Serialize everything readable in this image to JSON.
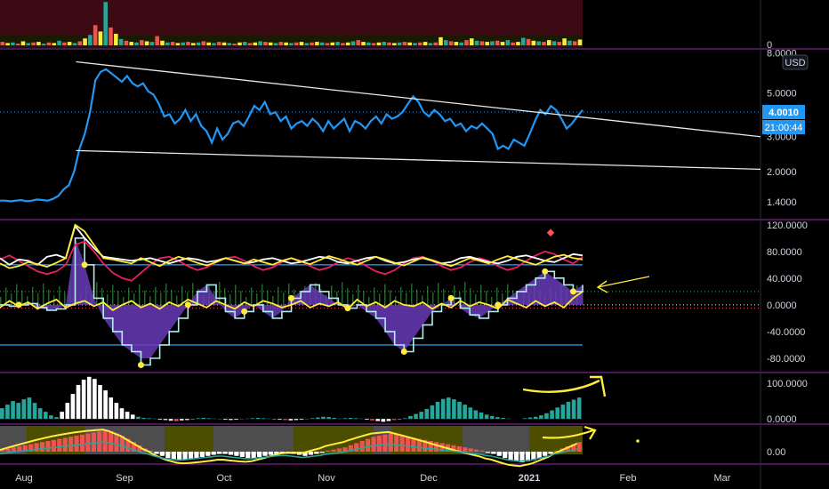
{
  "currency_button": "USD",
  "price_tag": "4.0010",
  "countdown_tag": "21:00:44",
  "colors": {
    "background": "#000000",
    "pane_border": "#9c27b0",
    "price_line": "#2196f3",
    "trendline": "#e8e8e8",
    "tag_blue": "#2196f3",
    "volume_bg": "#3b0a12",
    "osc_yellow": "#ffeb3b",
    "osc_white": "#ffffff",
    "osc_red": "#e91e63",
    "osc_purple": "#673ab7",
    "osc_green": "#4caf50",
    "hist_teal": "#26a69a",
    "hist_white": "#ffffff",
    "hist_red": "#ef5350",
    "level_blue": "#2196f3",
    "annotation_yellow": "#ffeb3b"
  },
  "chart_data": [
    {
      "type": "bar",
      "pane": "volume",
      "yticks": [
        "0"
      ],
      "ylim": [
        0,
        8
      ],
      "values": [
        0.6,
        0.4,
        0.5,
        0.3,
        0.7,
        0.4,
        0.5,
        0.6,
        0.3,
        0.5,
        0.4,
        0.8,
        0.5,
        0.6,
        0.4,
        0.7,
        1.2,
        1.8,
        3.5,
        2.4,
        7.5,
        3.1,
        2.0,
        1.1,
        0.8,
        0.6,
        0.5,
        0.9,
        0.7,
        0.6,
        1.6,
        0.8,
        0.5,
        0.6,
        0.4,
        0.5,
        0.6,
        0.4,
        0.5,
        0.7,
        0.5,
        0.4,
        0.6,
        0.5,
        0.4,
        0.3,
        0.5,
        0.6,
        0.4,
        0.5,
        0.7,
        0.6,
        0.5,
        0.4,
        0.6,
        0.5,
        0.4,
        0.5,
        0.6,
        0.4,
        0.5,
        0.6,
        0.5,
        0.4,
        0.5,
        0.6,
        0.4,
        0.5,
        0.7,
        0.9,
        0.6,
        0.5,
        0.4,
        0.5,
        0.6,
        0.5,
        0.4,
        0.5,
        0.6,
        0.5,
        0.4,
        0.5,
        0.6,
        0.4,
        0.5,
        1.4,
        0.9,
        0.7,
        0.6,
        0.5,
        0.9,
        1.2,
        0.8,
        0.7,
        0.6,
        0.7,
        0.8,
        0.6,
        0.9,
        0.5,
        0.6,
        1.3,
        1.1,
        0.8,
        0.7,
        0.6,
        0.9,
        0.7,
        0.6,
        1.2,
        0.8,
        0.7,
        1.0
      ]
    },
    {
      "type": "line",
      "pane": "price",
      "scale": "log",
      "x_labels": [
        "Aug",
        "Sep",
        "Oct",
        "Nov",
        "Dec",
        "2021",
        "Feb",
        "Mar"
      ],
      "yticks": [
        "8.0000",
        "5.0000",
        "3.0000",
        "2.0000",
        "1.4000"
      ],
      "ytick_values": [
        8,
        5,
        3,
        2,
        1.4
      ],
      "ylim": [
        1.15,
        8.2
      ],
      "last_value": 4.001,
      "series": [
        {
          "values": [
            1.42,
            1.42,
            1.41,
            1.42,
            1.43,
            1.41,
            1.42,
            1.44,
            1.43,
            1.42,
            1.45,
            1.5,
            1.62,
            1.7,
            2.0,
            2.6,
            3.1,
            4.0,
            5.8,
            6.4,
            6.6,
            6.3,
            6.0,
            5.7,
            6.1,
            5.6,
            5.4,
            5.6,
            5.1,
            4.9,
            4.4,
            3.8,
            3.9,
            3.5,
            3.7,
            4.1,
            3.6,
            3.9,
            3.4,
            3.2,
            2.8,
            3.3,
            2.9,
            3.1,
            3.5,
            3.6,
            3.4,
            3.8,
            4.3,
            4.1,
            4.5,
            3.9,
            4.0,
            3.6,
            3.8,
            3.3,
            3.5,
            3.6,
            3.4,
            3.7,
            3.5,
            3.2,
            3.6,
            3.3,
            3.5,
            3.7,
            3.2,
            3.6,
            3.5,
            3.3,
            3.6,
            3.8,
            3.5,
            3.9,
            3.7,
            3.8,
            4.0,
            4.4,
            4.8,
            4.5,
            4.0,
            3.8,
            4.1,
            3.9,
            3.6,
            3.7,
            3.4,
            3.5,
            3.2,
            3.4,
            3.3,
            3.5,
            3.3,
            3.1,
            2.6,
            2.7,
            2.6,
            2.9,
            2.8,
            2.7,
            3.1,
            3.6,
            4.1,
            3.9,
            4.3,
            4.1,
            3.7,
            3.3,
            3.5,
            3.8,
            4.1
          ]
        }
      ],
      "trendlines": [
        {
          "from": [
            18,
            7.2
          ],
          "to": [
            200,
            3.0
          ]
        },
        {
          "from": [
            18,
            2.55
          ],
          "to": [
            200,
            2.05
          ]
        }
      ]
    },
    {
      "type": "line",
      "pane": "oscillator",
      "yticks": [
        "120.0000",
        "80.0000",
        "40.0000",
        "0.0000",
        "-40.0000",
        "-80.0000"
      ],
      "ytick_values": [
        120,
        80,
        40,
        0,
        -40,
        -80
      ],
      "ylim": [
        -100,
        125
      ],
      "levels": [
        60,
        -60,
        20,
        -5
      ],
      "series": [
        {
          "values": [
            62,
            55,
            58,
            64,
            61,
            57,
            63,
            70,
            120,
            110,
            90,
            70,
            68,
            65,
            62,
            70,
            64,
            58,
            66,
            72,
            68,
            63,
            59,
            64,
            70,
            66,
            62,
            68,
            64,
            60,
            66,
            70,
            65,
            61,
            67,
            73,
            69,
            64,
            60,
            66,
            72,
            68,
            63,
            59,
            65,
            71,
            67,
            62,
            58,
            64,
            70,
            66,
            62,
            68,
            73,
            69,
            64,
            60,
            66,
            72,
            75,
            70,
            68
          ]
        },
        {
          "values": [
            70,
            60,
            68,
            66,
            60,
            72,
            75,
            70,
            118,
            100,
            85,
            72,
            70,
            68,
            66,
            68,
            70,
            66,
            62,
            66,
            70,
            68,
            64,
            66,
            70,
            66,
            62,
            64,
            68,
            70,
            66,
            62,
            64,
            68,
            72,
            70,
            64,
            62,
            66,
            70,
            72,
            66,
            62,
            64,
            68,
            70,
            66,
            62,
            64,
            70,
            72,
            68,
            64,
            62,
            66,
            72,
            74,
            70,
            66,
            64,
            70,
            76,
            74
          ]
        },
        {
          "values": [
            68,
            74,
            66,
            58,
            50,
            46,
            50,
            60,
            90,
            95,
            80,
            62,
            48,
            40,
            36,
            48,
            60,
            70,
            72,
            66,
            58,
            52,
            56,
            64,
            70,
            72,
            66,
            58,
            52,
            56,
            64,
            70,
            66,
            58,
            52,
            56,
            64,
            70,
            66,
            58,
            50,
            46,
            52,
            62,
            70,
            72,
            66,
            58,
            52,
            56,
            64,
            70,
            66,
            58,
            52,
            56,
            66,
            74,
            80,
            76,
            68,
            62,
            72
          ]
        },
        {
          "values": [
            -4,
            6,
            -2,
            4,
            -6,
            2,
            8,
            -4,
            2,
            6,
            -2,
            4,
            -8,
            0,
            6,
            -4,
            2,
            -6,
            4,
            -2,
            8,
            2,
            -4,
            6,
            0,
            -6,
            4,
            -2,
            6,
            2,
            -4,
            0,
            6,
            -4,
            2,
            -2,
            4,
            -6,
            8,
            -2,
            4,
            -4,
            6,
            0,
            -2,
            4,
            -6,
            2,
            -4,
            6,
            -2,
            4,
            0,
            -6,
            8,
            2,
            -4,
            6,
            -2,
            4,
            -4,
            10,
            20
          ]
        },
        {
          "values": [
            0,
            -2,
            0,
            2,
            -4,
            -8,
            -6,
            0,
            100,
            60,
            10,
            -20,
            -40,
            -60,
            -70,
            -90,
            -80,
            -60,
            -40,
            -20,
            0,
            20,
            30,
            10,
            -10,
            -20,
            -10,
            0,
            -10,
            -20,
            -10,
            10,
            20,
            30,
            20,
            10,
            0,
            -5,
            0,
            -10,
            -20,
            -40,
            -60,
            -70,
            -50,
            -30,
            -10,
            0,
            10,
            -5,
            -15,
            -20,
            -10,
            0,
            10,
            20,
            30,
            40,
            50,
            40,
            30,
            20,
            30
          ]
        }
      ]
    },
    {
      "type": "bar",
      "pane": "histogram_a",
      "yticks": [
        "100.0000",
        "0.0000"
      ],
      "ytick_values": [
        100,
        0
      ],
      "ylim": [
        -12,
        125
      ],
      "values": [
        30,
        40,
        50,
        45,
        55,
        60,
        45,
        30,
        20,
        10,
        5,
        20,
        45,
        70,
        95,
        110,
        118,
        112,
        95,
        80,
        60,
        45,
        30,
        20,
        12,
        6,
        3,
        2,
        1,
        -2,
        -3,
        -5,
        -6,
        -4,
        -3,
        -1,
        2,
        3,
        2,
        1,
        -1,
        -2,
        -3,
        -2,
        -1,
        1,
        2,
        3,
        2,
        1,
        -1,
        -2,
        -3,
        -4,
        -3,
        -2,
        -1,
        2,
        4,
        6,
        5,
        3,
        1,
        2,
        3,
        2,
        1,
        -2,
        -4,
        -6,
        -8,
        -6,
        -3,
        -1,
        2,
        8,
        14,
        20,
        28,
        38,
        48,
        56,
        60,
        55,
        48,
        40,
        32,
        24,
        18,
        12,
        8,
        5,
        3,
        1,
        0,
        0,
        2,
        4,
        6,
        10,
        16,
        24,
        32,
        40,
        48,
        54,
        60
      ]
    },
    {
      "type": "bar",
      "pane": "histogram_b",
      "yticks": [
        "0.00"
      ],
      "ytick_values": [
        0
      ],
      "ylim": [
        -1,
        1
      ],
      "values": [
        0.1,
        0.15,
        0.2,
        0.25,
        0.3,
        0.35,
        0.4,
        0.45,
        0.5,
        0.55,
        0.6,
        0.65,
        0.7,
        0.75,
        0.8,
        0.85,
        0.9,
        0.95,
        1.0,
        0.95,
        0.85,
        0.75,
        0.6,
        0.45,
        0.3,
        0.15,
        0.05,
        -0.1,
        -0.2,
        -0.3,
        -0.35,
        -0.4,
        -0.4,
        -0.35,
        -0.3,
        -0.25,
        -0.2,
        -0.15,
        -0.1,
        -0.1,
        -0.15,
        -0.2,
        -0.25,
        -0.3,
        -0.3,
        -0.25,
        -0.2,
        -0.15,
        -0.1,
        -0.05,
        -0.05,
        -0.1,
        -0.15,
        -0.2,
        -0.15,
        -0.1,
        -0.05,
        0.05,
        0.1,
        0.15,
        0.2,
        0.3,
        0.4,
        0.5,
        0.6,
        0.7,
        0.75,
        0.8,
        0.85,
        0.8,
        0.75,
        0.7,
        0.65,
        0.6,
        0.55,
        0.5,
        0.45,
        0.4,
        0.35,
        0.3,
        0.25,
        0.2,
        0.15,
        0.1,
        0.05,
        -0.05,
        -0.1,
        -0.2,
        -0.3,
        -0.4,
        -0.45,
        -0.5,
        -0.45,
        -0.4,
        -0.3,
        -0.2,
        -0.1,
        0.05,
        0.15,
        0.25,
        0.35,
        0.45
      ]
    }
  ]
}
